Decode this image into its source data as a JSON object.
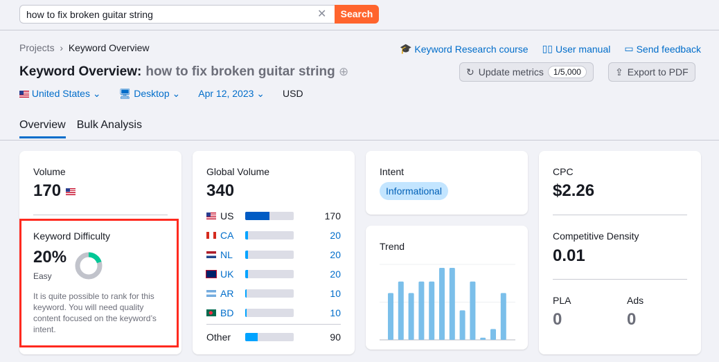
{
  "search": {
    "value": "how to fix broken guitar string",
    "button": "Search"
  },
  "breadcrumb": [
    "Projects",
    "Keyword Overview"
  ],
  "links": [
    "Keyword Research course",
    "User manual",
    "Send feedback"
  ],
  "title": {
    "prefix": "Keyword Overview:",
    "keyword": "how to fix broken guitar string"
  },
  "actions": {
    "update": "Update metrics",
    "update_count": "1/5,000",
    "export": "Export to PDF"
  },
  "filters": {
    "country": "United States",
    "device": "Desktop",
    "date": "Apr 12, 2023",
    "currency": "USD"
  },
  "tabs": [
    "Overview",
    "Bulk Analysis"
  ],
  "volume": {
    "label": "Volume",
    "value": "170"
  },
  "kd": {
    "label": "Keyword Difficulty",
    "value": "20%",
    "percent": 20,
    "level": "Easy",
    "description": "It is quite possible to rank for this keyword. You will need quality content focused on the keyword’s intent.",
    "color": "#00c896"
  },
  "global": {
    "label": "Global Volume",
    "value": "340",
    "rows": [
      {
        "code": "US",
        "value": "170",
        "share": 0.5,
        "color": "#005bc4"
      },
      {
        "code": "CA",
        "value": "20",
        "share": 0.05
      },
      {
        "code": "NL",
        "value": "20",
        "share": 0.05
      },
      {
        "code": "UK",
        "value": "20",
        "share": 0.05
      },
      {
        "code": "AR",
        "value": "10",
        "share": 0.03
      },
      {
        "code": "BD",
        "value": "10",
        "share": 0.03
      }
    ],
    "other": {
      "label": "Other",
      "value": "90",
      "share": 0.26
    }
  },
  "intent": {
    "label": "Intent",
    "value": "Informational"
  },
  "trend": {
    "label": "Trend",
    "values": [
      0.65,
      0.81,
      0.65,
      0.81,
      0.81,
      1,
      1,
      0.41,
      0.81,
      0.03,
      0.15,
      0.65
    ]
  },
  "cpc": {
    "label": "CPC",
    "value": "$2.26"
  },
  "density": {
    "label": "Competitive Density",
    "value": "0.01"
  },
  "pla": {
    "label": "PLA",
    "value": "0"
  },
  "ads": {
    "label": "Ads",
    "value": "0"
  }
}
